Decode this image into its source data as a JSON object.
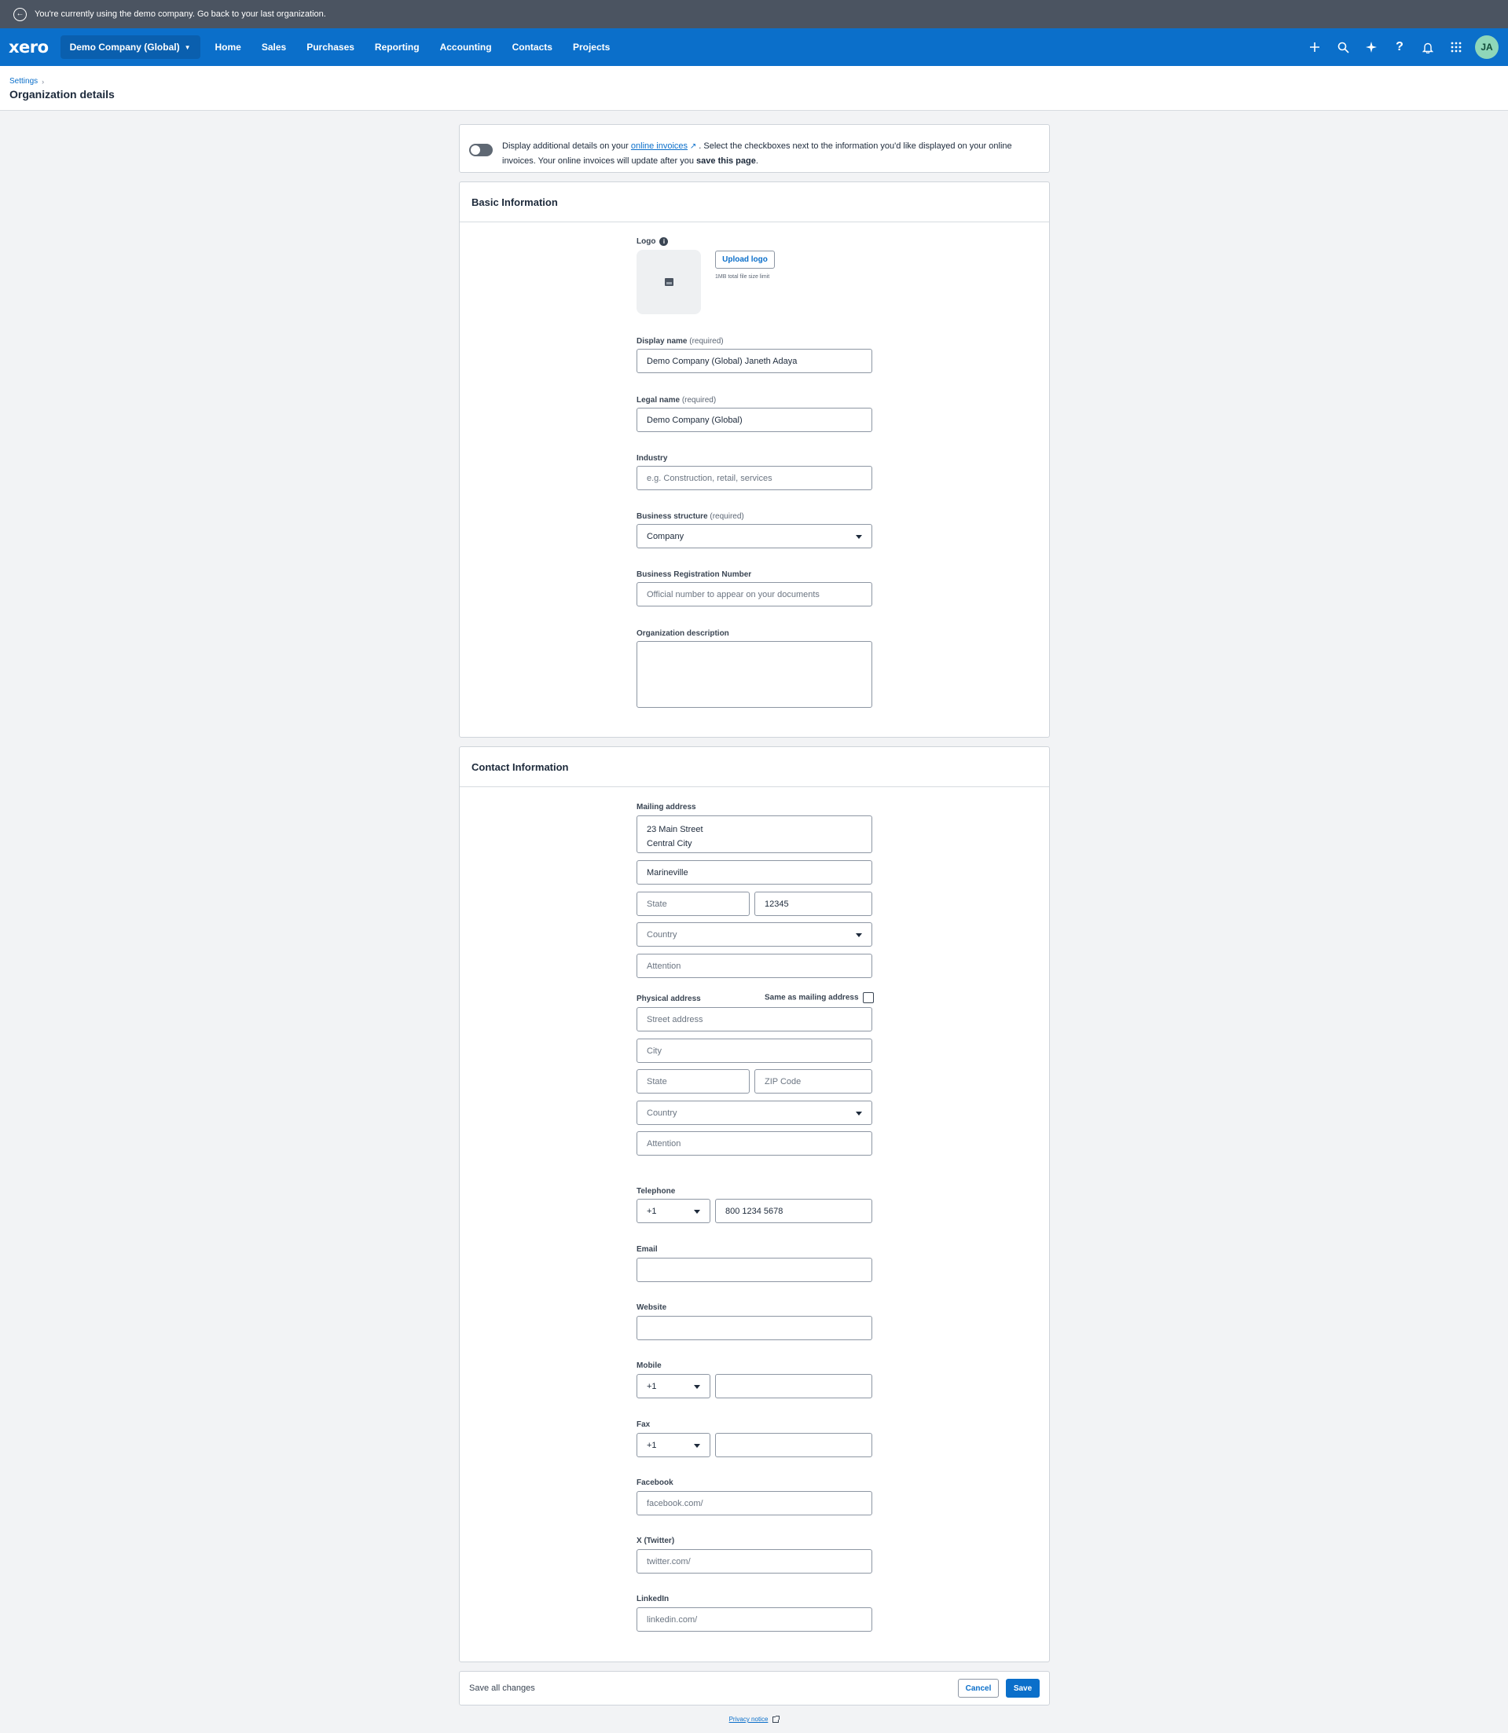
{
  "demo_banner": {
    "text": "You're currently using the demo company. Go back to your last organization."
  },
  "nav": {
    "logo": "xero",
    "org": "Demo Company (Global)",
    "items": [
      "Home",
      "Sales",
      "Purchases",
      "Reporting",
      "Accounting",
      "Contacts",
      "Projects"
    ],
    "icons": [
      "plus-icon",
      "search-icon",
      "sparkle-icon",
      "help-icon",
      "bell-icon",
      "apps-grid-icon"
    ],
    "avatar": "JA"
  },
  "breadcrumb": {
    "parent": "Settings"
  },
  "page_title": "Organization details",
  "online_invoices": {
    "text_before": "Display additional details on your",
    "link": "online invoices",
    "text_after": ". Select the checkboxes next to the information you'd like displayed on your online invoices. Your online invoices will update after you",
    "bold": "save this page",
    "end": "."
  },
  "basic": {
    "title": "Basic Information",
    "logo_label": "Logo",
    "upload_label": "Upload logo",
    "upload_hint": "1MB total file size limit",
    "display_name_label": "Display name",
    "required": "(required)",
    "display_name_value": "Demo Company (Global) Janeth Adaya",
    "legal_name_label": "Legal name",
    "legal_name_value": "Demo Company (Global)",
    "industry_label": "Industry",
    "industry_placeholder": "e.g. Construction, retail, services",
    "structure_label": "Business structure",
    "structure_value": "Company",
    "brn_label": "Business Registration Number",
    "brn_placeholder": "Official number to appear on your documents",
    "desc_label": "Organization description"
  },
  "contact": {
    "title": "Contact Information",
    "mailing_label": "Mailing address",
    "mailing_street_1": "23 Main Street",
    "mailing_street_2": "Central City",
    "mailing_city": "Marineville",
    "mailing_state_placeholder": "State",
    "mailing_zip": "12345",
    "mailing_country_placeholder": "Country",
    "mailing_attention_placeholder": "Attention",
    "physical_label": "Physical address",
    "same_as_mailing": "Same as mailing address",
    "physical_street_placeholder": "Street address",
    "physical_city_placeholder": "City",
    "physical_state_placeholder": "State",
    "physical_zip_placeholder": "ZIP Code",
    "physical_country_placeholder": "Country",
    "physical_attention_placeholder": "Attention",
    "telephone_label": "Telephone",
    "telephone_code": "+1",
    "telephone_value": "800 1234 5678",
    "email_label": "Email",
    "website_label": "Website",
    "mobile_label": "Mobile",
    "mobile_code": "+1",
    "fax_label": "Fax",
    "fax_code": "+1",
    "facebook_label": "Facebook",
    "facebook_prefix": "facebook.com/",
    "twitter_label": "X (Twitter)",
    "twitter_prefix": "twitter.com/",
    "linkedin_label": "LinkedIn",
    "linkedin_prefix": "linkedin.com/"
  },
  "footer": {
    "text": "Save all changes",
    "cancel": "Cancel",
    "save": "Save"
  },
  "privacy": "Privacy notice"
}
